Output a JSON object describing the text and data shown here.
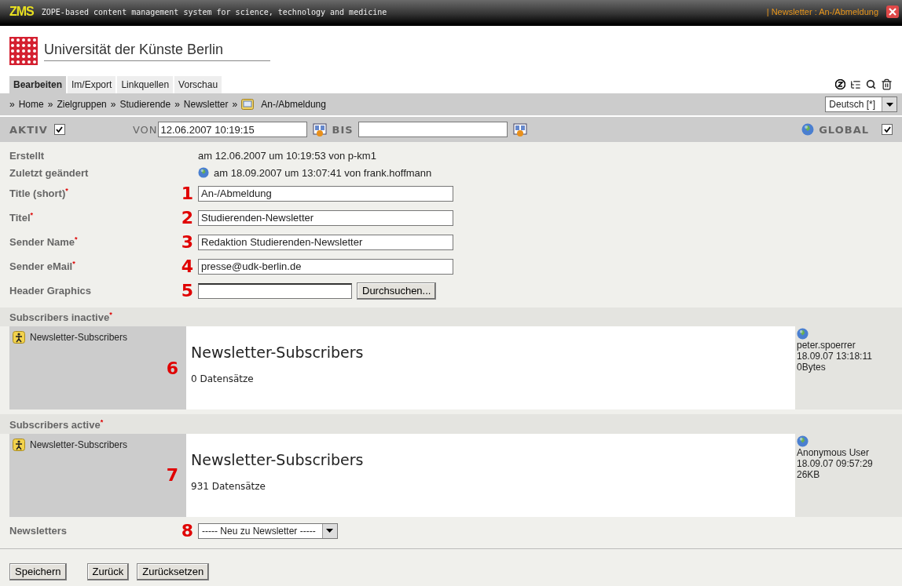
{
  "header": {
    "logo": "ZMS",
    "tagline": "ZOPE-based content management system for science, technology and medicine",
    "context": "| Newsletter : An-/Abmeldung"
  },
  "brand": {
    "name": "Universität der Künste Berlin"
  },
  "tabs": [
    {
      "label": "Bearbeiten",
      "selected": true
    },
    {
      "label": "Im/Export",
      "selected": false
    },
    {
      "label": "Linkquellen",
      "selected": false
    },
    {
      "label": "Vorschau",
      "selected": false
    }
  ],
  "breadcrumb": {
    "separator": "»",
    "items": [
      "Home",
      "Zielgruppen",
      "Studierende",
      "Newsletter"
    ],
    "current": "An-/Abmeldung"
  },
  "language": "Deutsch [*]",
  "activity": {
    "aktiv_label": "AKTIV",
    "aktiv_checked": true,
    "von_label": "VON",
    "von_value": "12.06.2007 10:19:15",
    "bis_label": "BIS",
    "global_label": "GLOBAL",
    "global_checked": true
  },
  "meta": [
    {
      "kind": "plain",
      "label": "Erstellt",
      "value": "am 12.06.2007 um 10:19:53 von p-km1"
    },
    {
      "kind": "globe",
      "label": "Zuletzt geändert",
      "value": "am 18.09.2007 um 13:07:41 von frank.hoffmann"
    }
  ],
  "fields": [
    {
      "kind": "text",
      "label": "Title (short)$^{*}$",
      "marker": "1",
      "value": "An-/Abmeldung"
    },
    {
      "kind": "text",
      "label": "Titel$^{*}$",
      "marker": "2",
      "value": "Studierenden-Newsletter"
    },
    {
      "kind": "text",
      "label": "Sender Name$^{*}$",
      "marker": "3",
      "value": "Redaktion Studierenden-Newsletter"
    },
    {
      "kind": "text",
      "label": "Sender eMail$^{*}$",
      "marker": "4",
      "value": "presse@udk-berlin.de"
    },
    {
      "kind": "file",
      "label": "Header Graphics",
      "marker": "5",
      "button": "Durchsuchen..."
    }
  ],
  "sections": [
    {
      "title": "Subscribers inactive$^{*}$",
      "item": "Newsletter-Subscribers",
      "marker": "6",
      "heading": "Newsletter-Subscribers",
      "count": "0 Datensätze",
      "info": [
        "peter.spoerrer",
        "18.09.07 13:18:11",
        "0Bytes"
      ]
    },
    {
      "title": "Subscribers active$^{*}$",
      "item": "Newsletter-Subscribers",
      "marker": "7",
      "heading": "Newsletter-Subscribers",
      "count": "931 Datensätze",
      "info": [
        "Anonymous User",
        "18.09.07 09:57:29",
        "26KB"
      ]
    }
  ],
  "newsletters": {
    "label": "Newsletters",
    "marker": "8",
    "select": "----- Neu zu Newsletter -----"
  },
  "buttons": [
    "Speichern",
    "Zurück",
    "Zurücksetzen"
  ]
}
